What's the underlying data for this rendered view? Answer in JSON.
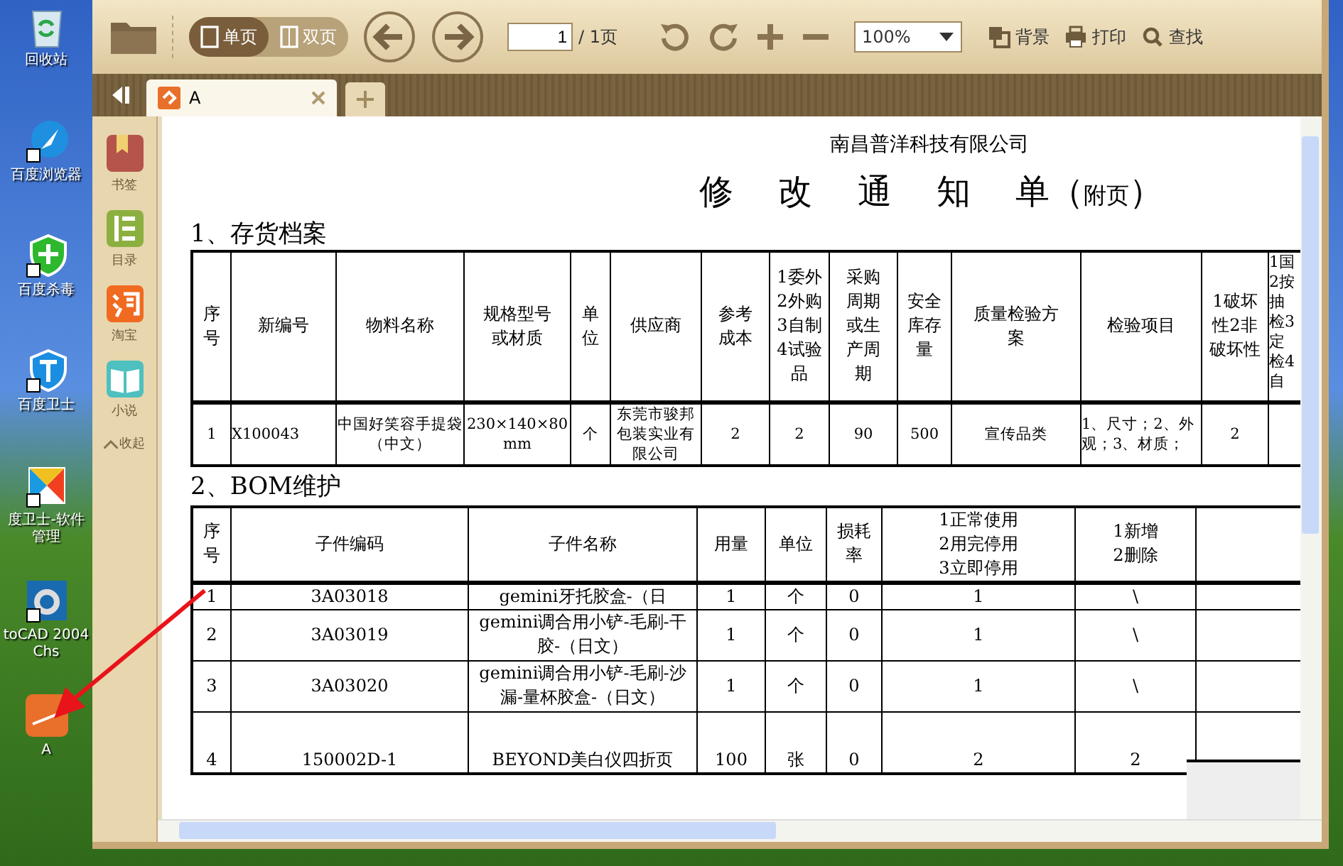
{
  "desktop_icons": [
    {
      "label": "回收站",
      "kind": "bin"
    },
    {
      "label": "百度浏览器",
      "kind": "browser"
    },
    {
      "label": "百度杀毒",
      "kind": "shield"
    },
    {
      "label": "百度卫士",
      "kind": "guard"
    },
    {
      "label": "度卫士-软件管理",
      "kind": "manager"
    },
    {
      "label": "toCAD 2004 Chs",
      "kind": "cad"
    },
    {
      "label": "A",
      "kind": "pdf"
    }
  ],
  "toolbar": {
    "view_modes": [
      {
        "label": "单页",
        "selected": true
      },
      {
        "label": "双页",
        "selected": false
      }
    ],
    "page_input": "1",
    "page_total": "/ 1页",
    "zoom": "100%",
    "actions": [
      {
        "label": "背景",
        "kind": "background"
      },
      {
        "label": "打印",
        "kind": "print"
      },
      {
        "label": "查找",
        "kind": "search"
      }
    ]
  },
  "tabs": [
    {
      "label": "A",
      "selected": true
    }
  ],
  "sidebar": {
    "items": [
      {
        "label": "书签",
        "kind": "bookmark"
      },
      {
        "label": "目录",
        "kind": "contents"
      },
      {
        "label": "淘宝",
        "kind": "taobao"
      },
      {
        "label": "小说",
        "kind": "book"
      }
    ],
    "collapse": "收起"
  },
  "document": {
    "company": "南昌普洋科技有限公司",
    "title": "修 改 通 知 单",
    "title_open": "（",
    "title_note": "附页",
    "title_close": "）",
    "section1": "1、存货档案",
    "table1": {
      "columns": [
        "序号",
        "新编号",
        "物料名称",
        "规格型号或材质",
        "单位",
        "供应商",
        "参考成本",
        "1委外2外购3自制4试验品",
        "采购周期或生产周期",
        "安全库存量",
        "质量检验方案",
        "检验项目",
        "1破坏性2非破坏性",
        "1国2按抽检3定检4自"
      ],
      "rows": [
        [
          "1",
          "X100043",
          "中国好笑容手提袋（中文）",
          "230×140×80mm",
          "个",
          "东莞市骏邦包装实业有限公司",
          "2",
          "2",
          "90",
          "500",
          "宣传品类",
          "1、尺寸；2、外观；3、材质；",
          "2",
          ""
        ]
      ]
    },
    "section2": "2、BOM维护",
    "table2": {
      "columns": [
        "序号",
        "子件编码",
        "子件名称",
        "用量",
        "单位",
        "损耗率",
        "1正常使用2用完停用3立即停用",
        "1新增2删除",
        ""
      ],
      "rows": [
        [
          "1",
          "3A03018",
          "gemini牙托胶盒-（日",
          "1",
          "个",
          "0",
          "1",
          "\\",
          ""
        ],
        [
          "2",
          "3A03019",
          "gemini调合用小铲-毛刷-干胶-（日文）",
          "1",
          "个",
          "0",
          "1",
          "\\",
          ""
        ],
        [
          "3",
          "3A03020",
          "gemini调合用小铲-毛刷-沙漏-量杯胶盒-（日文）",
          "1",
          "个",
          "0",
          "1",
          "\\",
          ""
        ],
        [
          "4",
          "150002D-1",
          "BEYOND美白仪四折页",
          "100",
          "张",
          "0",
          "2",
          "2",
          ""
        ]
      ]
    }
  }
}
